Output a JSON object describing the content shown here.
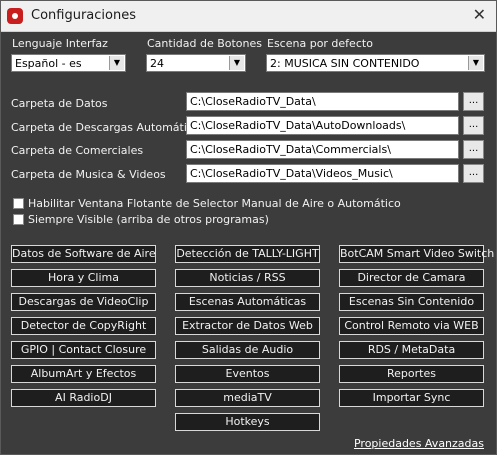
{
  "window": {
    "title": "Configuraciones",
    "icon": "app-record-icon",
    "close_glyph": "✕"
  },
  "selects": {
    "language": {
      "label": "Lenguaje Interfaz",
      "value": "Español - es"
    },
    "buttons_count": {
      "label": "Cantidad de Botones",
      "value": "24"
    },
    "default_scene": {
      "label": "Escena por defecto",
      "value": "2: MUSICA SIN CONTENIDO"
    }
  },
  "arrow_glyph": "▼",
  "paths": [
    {
      "label": "Carpeta de Datos",
      "value": "C:\\CloseRadioTV_Data\\",
      "browse": "..."
    },
    {
      "label": "Carpeta de Descargas Automáticas",
      "value": "C:\\CloseRadioTV_Data\\AutoDownloads\\",
      "browse": "..."
    },
    {
      "label": "Carpeta de Comerciales",
      "value": "C:\\CloseRadioTV_Data\\Commercials\\",
      "browse": "..."
    },
    {
      "label": "Carpeta de Musica & Videos",
      "value": "C:\\CloseRadioTV_Data\\Videos_Music\\",
      "browse": "..."
    }
  ],
  "checkboxes": [
    {
      "label": "Habilitar Ventana Flotante de Selector Manual de Aire o Automático",
      "checked": false
    },
    {
      "label": "Siempre Visible (arriba de otros programas)",
      "checked": false
    }
  ],
  "buttons": {
    "col1": [
      "Datos de Software de Aire",
      "Hora y Clima",
      "Descargas de VideoClip",
      "Detector de CopyRight",
      "GPIO | Contact Closure",
      "AlbumArt y Efectos",
      "AI RadioDJ"
    ],
    "col2": [
      "Detección de TALLY-LIGHT",
      "Noticias / RSS",
      "Escenas Automáticas",
      "Extractor de Datos Web",
      "Salidas de Audio",
      "Eventos",
      "mediaTV",
      "Hotkeys"
    ],
    "col3": [
      "BotCAM Smart Video Switch",
      "Director de Camara",
      "Escenas Sin Contenido",
      "Control Remoto via WEB",
      "RDS / MetaData",
      "Reportes",
      "Importar Sync"
    ]
  },
  "advanced_link": "Propiedades Avanzadas"
}
